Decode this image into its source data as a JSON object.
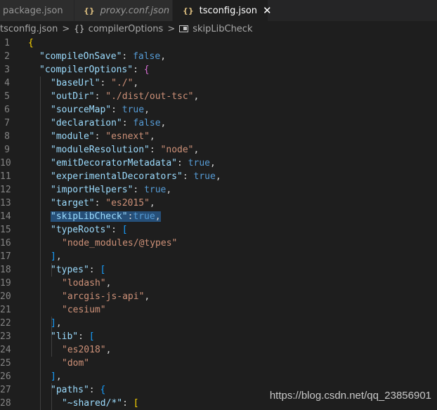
{
  "tabs": [
    {
      "label": "package.json"
    },
    {
      "label": "proxy.conf.json",
      "icon": "{}"
    },
    {
      "label": "tsconfig.json",
      "icon": "{}",
      "close": "✕"
    }
  ],
  "breadcrumb": {
    "file": "tsconfig.json",
    "separator": ">",
    "node1": "compilerOptions",
    "node1_icon": "{}",
    "node2": "skipLibCheck"
  },
  "lines": [
    {
      "n": "1",
      "indent": 0,
      "t": [
        [
          "{",
          "br1"
        ]
      ]
    },
    {
      "n": "2",
      "indent": 1,
      "t": [
        [
          "\"compileOnSave\"",
          "k"
        ],
        [
          ": ",
          "p"
        ],
        [
          "false",
          "b"
        ],
        [
          ",",
          "p"
        ]
      ]
    },
    {
      "n": "3",
      "indent": 1,
      "t": [
        [
          "\"compilerOptions\"",
          "k"
        ],
        [
          ": ",
          "p"
        ],
        [
          "{",
          "br2"
        ]
      ]
    },
    {
      "n": "4",
      "indent": 2,
      "t": [
        [
          "\"baseUrl\"",
          "k"
        ],
        [
          ": ",
          "p"
        ],
        [
          "\"./\"",
          "s"
        ],
        [
          ",",
          "p"
        ]
      ]
    },
    {
      "n": "5",
      "indent": 2,
      "t": [
        [
          "\"outDir\"",
          "k"
        ],
        [
          ": ",
          "p"
        ],
        [
          "\"./dist/out-tsc\"",
          "s"
        ],
        [
          ",",
          "p"
        ]
      ]
    },
    {
      "n": "6",
      "indent": 2,
      "t": [
        [
          "\"sourceMap\"",
          "k"
        ],
        [
          ": ",
          "p"
        ],
        [
          "true",
          "b"
        ],
        [
          ",",
          "p"
        ]
      ]
    },
    {
      "n": "7",
      "indent": 2,
      "t": [
        [
          "\"declaration\"",
          "k"
        ],
        [
          ": ",
          "p"
        ],
        [
          "false",
          "b"
        ],
        [
          ",",
          "p"
        ]
      ]
    },
    {
      "n": "8",
      "indent": 2,
      "t": [
        [
          "\"module\"",
          "k"
        ],
        [
          ": ",
          "p"
        ],
        [
          "\"esnext\"",
          "s"
        ],
        [
          ",",
          "p"
        ]
      ]
    },
    {
      "n": "9",
      "indent": 2,
      "t": [
        [
          "\"moduleResolution\"",
          "k"
        ],
        [
          ": ",
          "p"
        ],
        [
          "\"node\"",
          "s"
        ],
        [
          ",",
          "p"
        ]
      ]
    },
    {
      "n": "10",
      "indent": 2,
      "t": [
        [
          "\"emitDecoratorMetadata\"",
          "k"
        ],
        [
          ": ",
          "p"
        ],
        [
          "true",
          "b"
        ],
        [
          ",",
          "p"
        ]
      ]
    },
    {
      "n": "11",
      "indent": 2,
      "t": [
        [
          "\"experimentalDecorators\"",
          "k"
        ],
        [
          ": ",
          "p"
        ],
        [
          "true",
          "b"
        ],
        [
          ",",
          "p"
        ]
      ]
    },
    {
      "n": "12",
      "indent": 2,
      "t": [
        [
          "\"importHelpers\"",
          "k"
        ],
        [
          ": ",
          "p"
        ],
        [
          "true",
          "b"
        ],
        [
          ",",
          "p"
        ]
      ]
    },
    {
      "n": "13",
      "indent": 2,
      "t": [
        [
          "\"target\"",
          "k"
        ],
        [
          ": ",
          "p"
        ],
        [
          "\"es2015\"",
          "s"
        ],
        [
          ",",
          "p"
        ]
      ]
    },
    {
      "n": "14",
      "indent": 2,
      "sel": true,
      "t": [
        [
          "\"skipLibCheck\"",
          "k"
        ],
        [
          ":",
          "p"
        ],
        [
          "true",
          "b"
        ],
        [
          ",",
          "p"
        ]
      ]
    },
    {
      "n": "15",
      "indent": 2,
      "t": [
        [
          "\"typeRoots\"",
          "k"
        ],
        [
          ": ",
          "p"
        ],
        [
          "[",
          "br3"
        ]
      ]
    },
    {
      "n": "16",
      "indent": 3,
      "t": [
        [
          "\"node_modules/@types\"",
          "s"
        ]
      ]
    },
    {
      "n": "17",
      "indent": 2,
      "t": [
        [
          "]",
          "br3"
        ],
        [
          ",",
          "p"
        ]
      ]
    },
    {
      "n": "18",
      "indent": 2,
      "t": [
        [
          "\"types\"",
          "k"
        ],
        [
          ": ",
          "p"
        ],
        [
          "[",
          "br3"
        ]
      ]
    },
    {
      "n": "19",
      "indent": 3,
      "t": [
        [
          "\"lodash\"",
          "s"
        ],
        [
          ",",
          "p"
        ]
      ]
    },
    {
      "n": "20",
      "indent": 3,
      "t": [
        [
          "\"arcgis-js-api\"",
          "s"
        ],
        [
          ",",
          "p"
        ]
      ]
    },
    {
      "n": "21",
      "indent": 3,
      "t": [
        [
          "\"cesium\"",
          "s"
        ]
      ]
    },
    {
      "n": "22",
      "indent": 2,
      "t": [
        [
          "]",
          "br3"
        ],
        [
          ",",
          "p"
        ]
      ]
    },
    {
      "n": "23",
      "indent": 2,
      "t": [
        [
          "\"lib\"",
          "k"
        ],
        [
          ": ",
          "p"
        ],
        [
          "[",
          "br3"
        ]
      ]
    },
    {
      "n": "24",
      "indent": 3,
      "t": [
        [
          "\"es2018\"",
          "s"
        ],
        [
          ",",
          "p"
        ]
      ]
    },
    {
      "n": "25",
      "indent": 3,
      "t": [
        [
          "\"dom\"",
          "s"
        ]
      ]
    },
    {
      "n": "26",
      "indent": 2,
      "t": [
        [
          "]",
          "br3"
        ],
        [
          ",",
          "p"
        ]
      ]
    },
    {
      "n": "27",
      "indent": 2,
      "t": [
        [
          "\"paths\"",
          "k"
        ],
        [
          ": ",
          "p"
        ],
        [
          "{",
          "br3"
        ]
      ]
    },
    {
      "n": "28",
      "indent": 3,
      "t": [
        [
          "\"~shared/*\"",
          "k"
        ],
        [
          ": ",
          "p"
        ],
        [
          "[",
          "br1"
        ]
      ]
    }
  ],
  "watermark": "https://blog.csdn.net/qq_23856901",
  "colors": {
    "editor_bg": "#1e1e1e",
    "key": "#9cdcfe",
    "string": "#ce9178",
    "boolean": "#569cd6",
    "selection": "#264f78"
  }
}
